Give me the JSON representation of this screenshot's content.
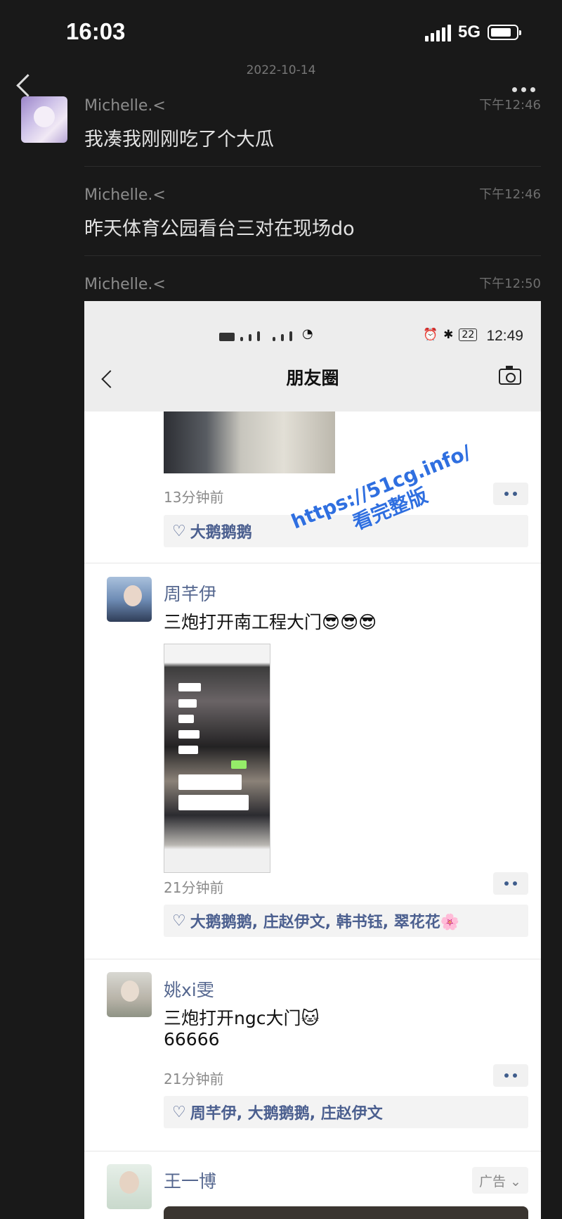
{
  "status_bar": {
    "time": "16:03",
    "network": "5G"
  },
  "chat": {
    "date": "2022-10-14",
    "messages": [
      {
        "sender": "Michelle.<",
        "time": "下午12:46",
        "text": "我凑我刚刚吃了个大瓜"
      },
      {
        "sender": "Michelle.<",
        "time": "下午12:46",
        "text": "昨天体育公园看台三对在现场do"
      },
      {
        "sender": "Michelle.<",
        "time": "下午12:50",
        "text": ""
      }
    ]
  },
  "screenshot": {
    "inner_time": "12:49",
    "inner_battery": "22",
    "title": "朋友圈",
    "posts": [
      {
        "ago": "13分钟前",
        "likes": "大鹅鹅鹅"
      },
      {
        "name": "周芊伊",
        "text": "三炮打开南工程大门😎😎😎",
        "ago": "21分钟前",
        "likes": "大鹅鹅鹅, 庄赵伊文, 韩书钰, 翠花花🌸"
      },
      {
        "name": "姚xi雯",
        "text": "三炮打开ngc大门🐱",
        "text2": "66666",
        "ago": "21分钟前",
        "likes": "周芊伊, 大鹅鹅鹅, 庄赵伊文"
      },
      {
        "name": "王一博",
        "ad": "广告 ⌄"
      }
    ]
  },
  "watermark": {
    "line1": "https://51cg.info/",
    "line2": "看完整版"
  }
}
